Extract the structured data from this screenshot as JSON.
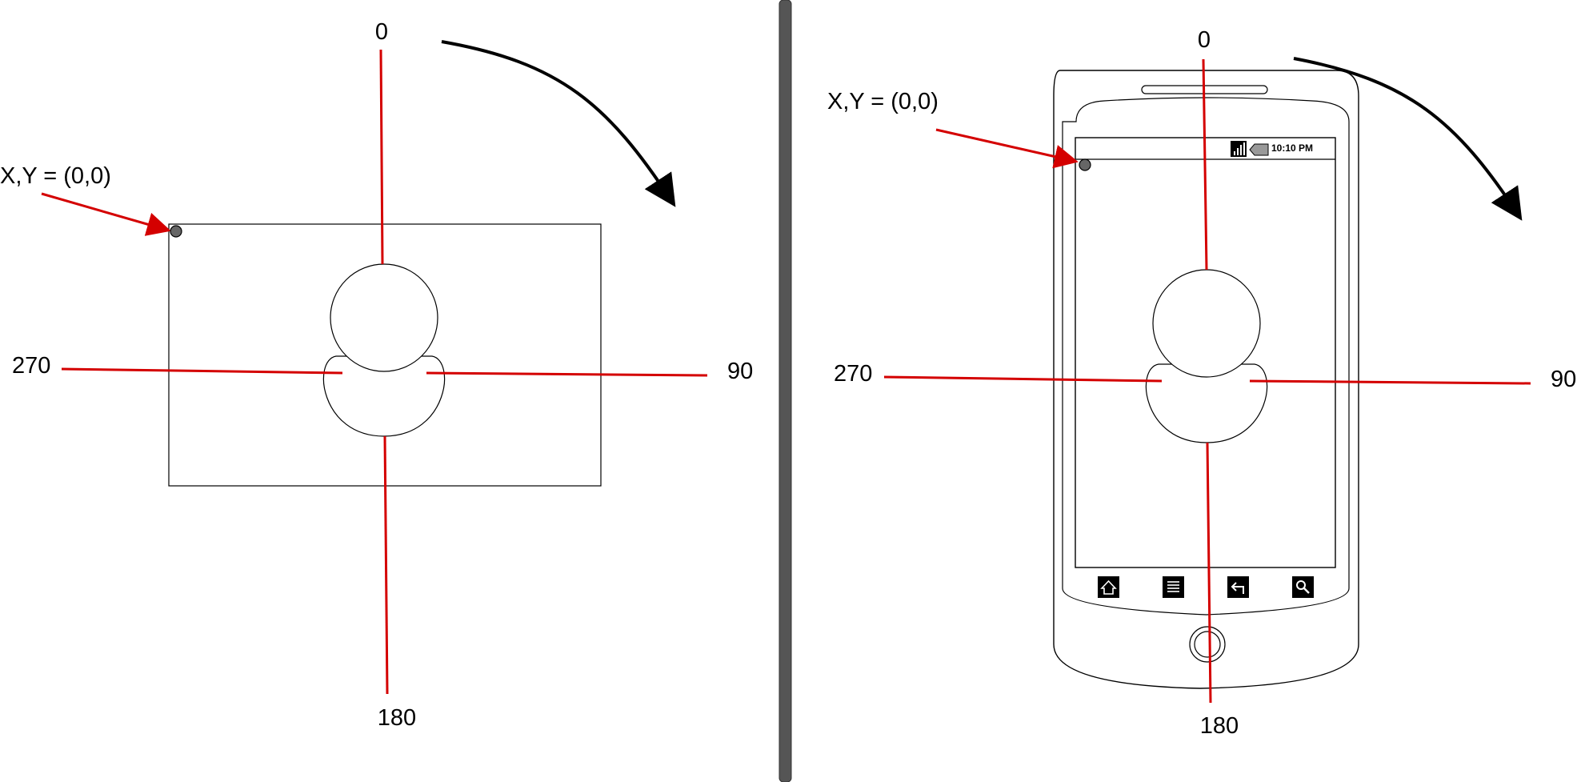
{
  "left_panel": {
    "labels": {
      "top": "0",
      "right": "90",
      "bottom": "180",
      "left": "270",
      "origin": "X,Y = (0,0)"
    }
  },
  "right_panel": {
    "labels": {
      "top": "0",
      "right": "90",
      "bottom": "180",
      "left": "270",
      "origin": "X,Y = (0,0)"
    },
    "phone": {
      "status_time": "10:10 PM",
      "nav_icons": [
        "home-icon",
        "menu-icon",
        "back-icon",
        "search-icon"
      ]
    }
  },
  "colors": {
    "axis": "#d40000",
    "outline": "#000000",
    "divider": "#555555",
    "origin_dot": "#666666"
  }
}
